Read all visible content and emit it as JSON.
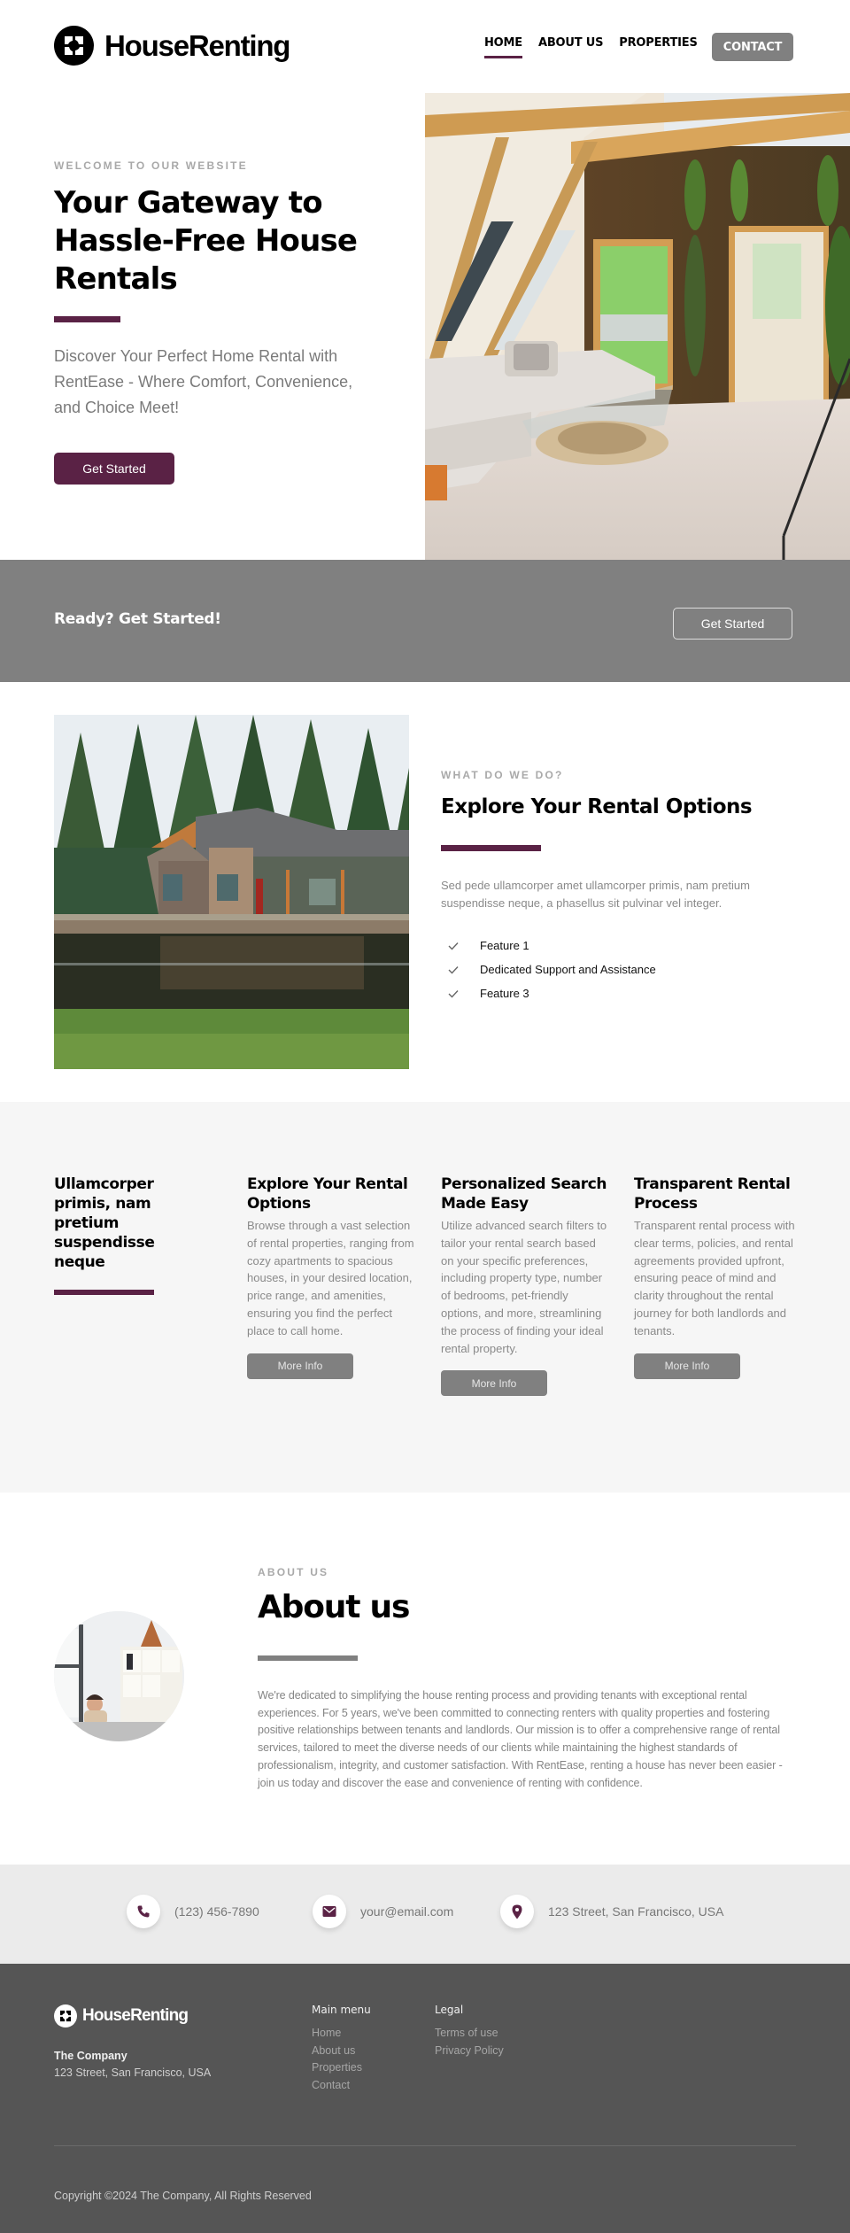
{
  "brand": {
    "name": "HouseRenting",
    "accent_color": "#5a2245",
    "gray_color": "#808080"
  },
  "nav": {
    "items": [
      {
        "label": "HOME",
        "active": true
      },
      {
        "label": "ABOUT US",
        "active": false
      },
      {
        "label": "PROPERTIES",
        "active": false
      }
    ],
    "contact_label": "CONTACT"
  },
  "hero": {
    "eyebrow": "WELCOME TO OUR WEBSITE",
    "title": "Your Gateway to Hassle-Free House Rentals",
    "subtitle": "Discover Your Perfect Home Rental with RentEase - Where Comfort, Convenience, and Choice Meet!",
    "button_label": "Get Started",
    "image_alt": "Cozy A-frame cabin living room with white sofa and plants"
  },
  "cta": {
    "text": "Ready? Get Started!",
    "button_label": "Get Started"
  },
  "features": {
    "image_alt": "Cabin house beside a pond surrounded by pine trees",
    "eyebrow": "WHAT DO WE DO?",
    "title": "Explore Your Rental Options",
    "description": "Sed pede ullamcorper amet ullamcorper primis, nam pretium suspendisse neque, a phasellus sit pulvinar vel integer.",
    "list": [
      "Feature 1",
      "Dedicated Support and Assistance",
      "Feature 3"
    ]
  },
  "services": {
    "intro_title": "Ullamcorper primis, nam pretium suspendisse neque",
    "items": [
      {
        "title": "Explore Your Rental Options",
        "description": "Browse through a vast selection of rental properties, ranging from cozy apartments to spacious houses, in your desired location, price range, and amenities, ensuring you find the perfect place to call home.",
        "button_label": "More Info"
      },
      {
        "title": "Personalized Search Made Easy",
        "description": "Utilize advanced search filters to tailor your rental search based on your specific preferences, including property type, number of bedrooms, pet-friendly options, and more, streamlining the process of finding your ideal rental property.",
        "button_label": "More Info"
      },
      {
        "title": "Transparent Rental Process",
        "description": "Transparent rental process with clear terms, policies, and rental agreements provided upfront, ensuring peace of mind and clarity throughout the rental journey for both landlords and tenants.",
        "button_label": "More Info"
      }
    ]
  },
  "about": {
    "eyebrow": "ABOUT US",
    "title": "About us",
    "text": "We're dedicated to simplifying the house renting process and providing tenants with exceptional rental experiences. For 5 years, we've been committed to connecting renters with quality properties and fostering positive relationships between tenants and landlords. Our mission is to offer a comprehensive range of rental services, tailored to meet the diverse needs of our clients while maintaining the highest standards of professionalism, integrity, and customer satisfaction. With RentEase, renting a house has never been easier - join us today and discover the ease and convenience of renting with confidence.",
    "image_alt": "Smiling woman at office desk"
  },
  "contact": {
    "items": [
      {
        "icon": "phone-icon",
        "text": "(123) 456-7890"
      },
      {
        "icon": "envelope-icon",
        "text": "your@email.com"
      },
      {
        "icon": "map-pin-icon",
        "text": "123 Street, San Francisco, USA"
      }
    ]
  },
  "footer": {
    "brand": "HouseRenting",
    "company": "The Company",
    "address": "123 Street, San Francisco, USA",
    "columns": [
      {
        "title": "Main menu",
        "links": [
          "Home",
          "About us",
          "Properties",
          "Contact"
        ]
      },
      {
        "title": "Legal",
        "links": [
          "Terms of use",
          "Privacy Policy"
        ]
      }
    ],
    "copyright": "Copyright ©2024 The Company, All Rights Reserved"
  }
}
